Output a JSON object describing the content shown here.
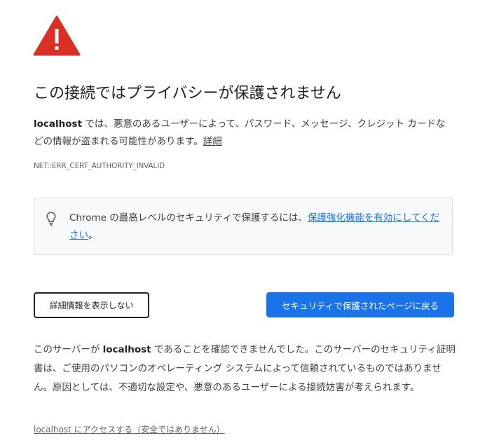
{
  "page": {
    "title": "この接続ではプライバシーが保護されません",
    "intro": {
      "host": "localhost",
      "text": " では、悪意のあるユーザーによって、パスワード、メッセージ、クレジット カードなどの情報が盗まれる可能性があります。",
      "learn_more_link": "詳細"
    },
    "error_code": "NET::ERR_CERT_AUTHORITY_INVALID",
    "enhanced_protection": {
      "icon": "lightbulb-icon",
      "text_before": "Chrome の最高レベルのセキュリティで保護するには、",
      "link": "保護強化機能を有効にしてください",
      "text_after": "。"
    },
    "buttons": {
      "hide_details": "詳細情報を表示しない",
      "back_to_safety": "セキュリティで保護されたページに戻る"
    },
    "details": {
      "prefix": "このサーバーが ",
      "host": "localhost",
      "suffix": " であることを確認できませんでした。このサーバーのセキュリティ証明書は、ご使用のパソコンのオペレーティング システムによって信頼されているものではありません。原因としては、不適切な設定や、悪意のあるユーザーによる接続妨害が考えられます。"
    },
    "proceed_link": "localhost にアクセスする（安全ではありません）"
  },
  "colors": {
    "warning_red": "#d93025",
    "primary_blue": "#1a73e8",
    "text": "#202124",
    "secondary_text": "#5f6368",
    "box_background": "#f8f9fa"
  }
}
